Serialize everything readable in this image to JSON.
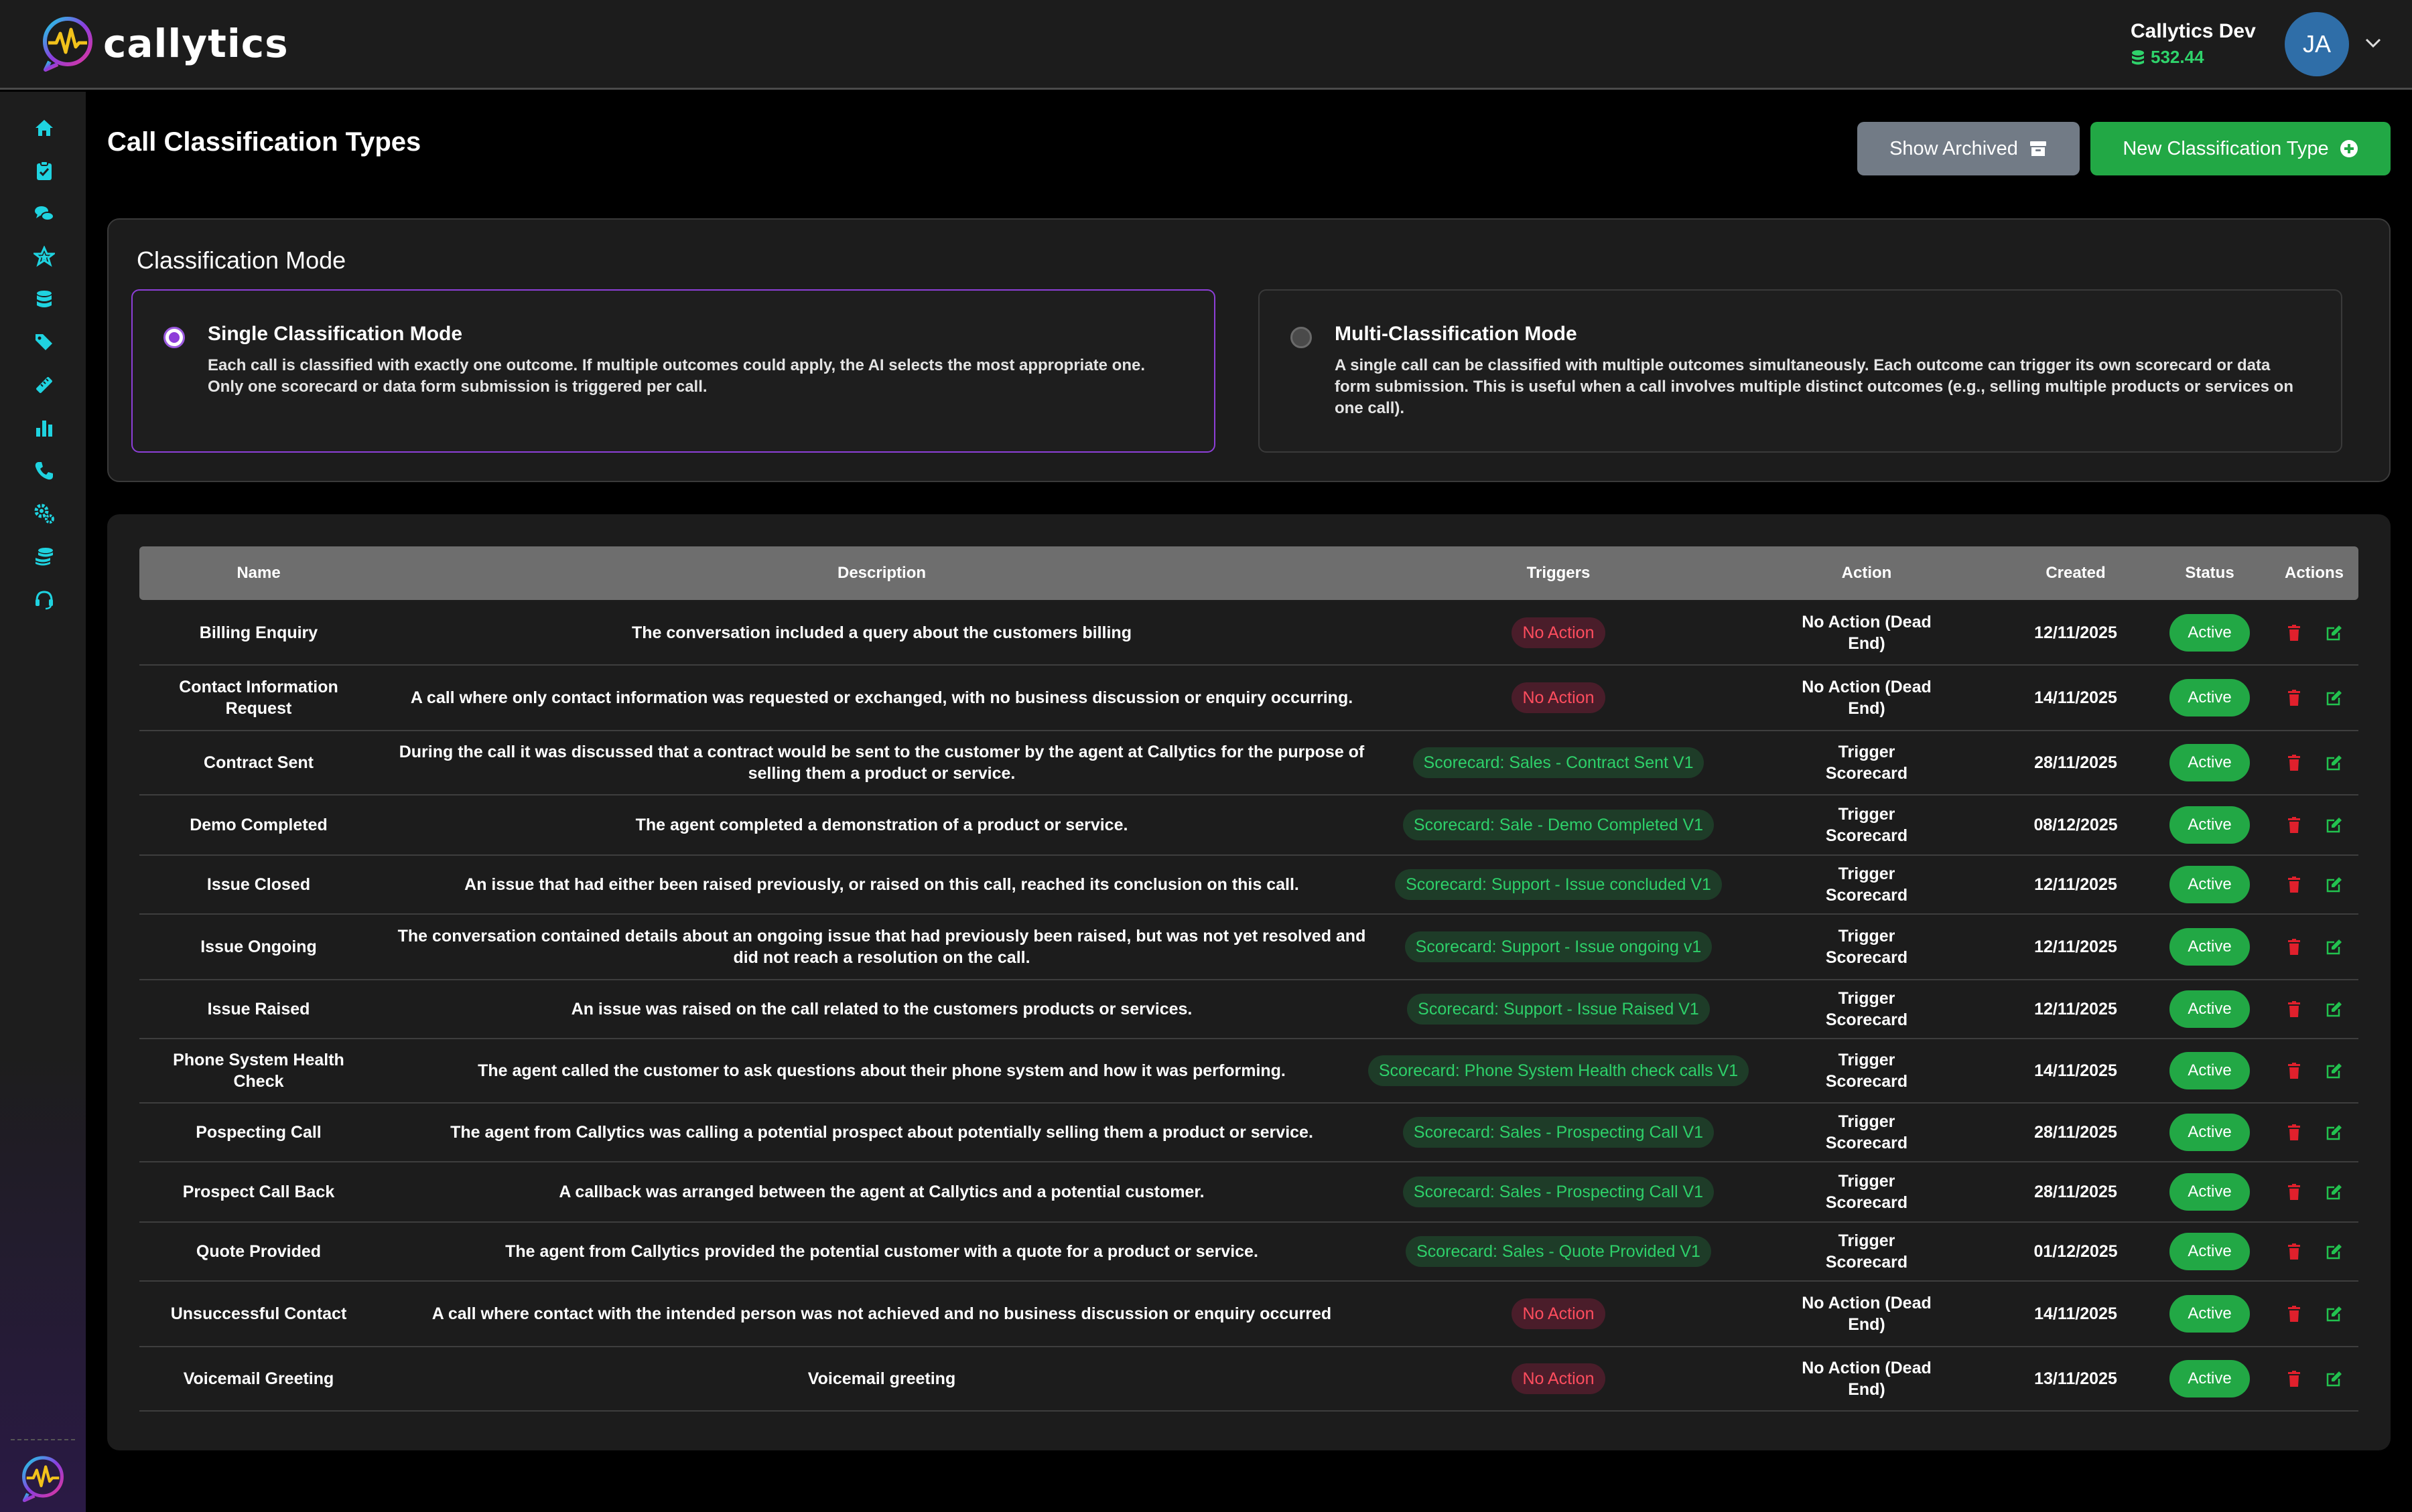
{
  "app": {
    "logo_text": "callytics",
    "account_name": "Callytics Dev",
    "credit": "532.44",
    "avatar_initials": "JA"
  },
  "sidebar": {
    "items": [
      "home-icon",
      "clipboard-check-icon",
      "chat-bubbles-icon",
      "star-icon",
      "database-icon",
      "tags-icon",
      "ruler-icon",
      "bar-chart-icon",
      "phone-icon",
      "gears-icon",
      "coins-icon",
      "headset-icon"
    ]
  },
  "page": {
    "title": "Call Classification Types",
    "show_archived_label": "Show Archived",
    "new_type_label": "New Classification Type"
  },
  "mode": {
    "title": "Classification Mode",
    "single": {
      "title": "Single Classification Mode",
      "desc": "Each call is classified with exactly one outcome. If multiple outcomes could apply, the AI selects the most appropriate one. Only one scorecard or data form submission is triggered per call.",
      "selected": true
    },
    "multi": {
      "title": "Multi-Classification Mode",
      "desc": "A single call can be classified with multiple outcomes simultaneously. Each outcome can trigger its own scorecard or data form submission. This is useful when a call involves multiple distinct outcomes (e.g., selling multiple products or services on one call).",
      "selected": false
    }
  },
  "table": {
    "headers": {
      "name": "Name",
      "description": "Description",
      "triggers": "Triggers",
      "action": "Action",
      "created": "Created",
      "status": "Status",
      "actions": "Actions"
    },
    "rows": [
      {
        "name": "Billing Enquiry",
        "description": "The conversation included a query about the customers billing",
        "trigger": "No Action",
        "trigger_type": "none",
        "action": "No Action (Dead End)",
        "created": "12/11/2025",
        "status": "Active"
      },
      {
        "name": "Contact Information Request",
        "description": "A call where only contact information was requested or exchanged, with no business discussion or enquiry occurring.",
        "trigger": "No Action",
        "trigger_type": "none",
        "action": "No Action (Dead End)",
        "created": "14/11/2025",
        "status": "Active"
      },
      {
        "name": "Contract Sent",
        "description": "During the call it was discussed that a contract would be sent to the customer by the agent at Callytics for the purpose of selling them a product or service.",
        "trigger": "Scorecard: Sales - Contract Sent V1",
        "trigger_type": "score",
        "action": "Trigger Scorecard",
        "created": "28/11/2025",
        "status": "Active"
      },
      {
        "name": "Demo Completed",
        "description": "The agent completed a demonstration of a product or service.",
        "trigger": "Scorecard: Sale - Demo Completed V1",
        "trigger_type": "score",
        "action": "Trigger Scorecard",
        "created": "08/12/2025",
        "status": "Active"
      },
      {
        "name": "Issue Closed",
        "description": "An issue that had either been raised previously, or raised on this call, reached its conclusion on this call.",
        "trigger": "Scorecard: Support - Issue concluded V1",
        "trigger_type": "score",
        "action": "Trigger Scorecard",
        "created": "12/11/2025",
        "status": "Active"
      },
      {
        "name": "Issue Ongoing",
        "description": "The conversation contained details about an ongoing issue that had previously been raised, but was not yet resolved and did not reach a resolution on the call.",
        "trigger": "Scorecard: Support - Issue ongoing v1",
        "trigger_type": "score",
        "action": "Trigger Scorecard",
        "created": "12/11/2025",
        "status": "Active"
      },
      {
        "name": "Issue Raised",
        "description": "An issue was raised on the call related to the customers products or services.",
        "trigger": "Scorecard: Support - Issue Raised V1",
        "trigger_type": "score",
        "action": "Trigger Scorecard",
        "created": "12/11/2025",
        "status": "Active"
      },
      {
        "name": "Phone System Health Check",
        "description": "The agent called the customer to ask questions about their phone system and how it was performing.",
        "trigger": "Scorecard: Phone System Health check calls V1",
        "trigger_type": "score",
        "action": "Trigger Scorecard",
        "created": "14/11/2025",
        "status": "Active"
      },
      {
        "name": "Pospecting Call",
        "description": "The agent from Callytics was calling a potential prospect about potentially selling them a product or service.",
        "trigger": "Scorecard: Sales - Prospecting Call V1",
        "trigger_type": "score",
        "action": "Trigger Scorecard",
        "created": "28/11/2025",
        "status": "Active"
      },
      {
        "name": "Prospect Call Back",
        "description": "A callback was arranged between the agent at Callytics and a potential customer.",
        "trigger": "Scorecard: Sales - Prospecting Call V1",
        "trigger_type": "score",
        "action": "Trigger Scorecard",
        "created": "28/11/2025",
        "status": "Active"
      },
      {
        "name": "Quote Provided",
        "description": "The agent from Callytics provided the potential customer with a quote for a product or service.",
        "trigger": "Scorecard: Sales - Quote Provided V1",
        "trigger_type": "score",
        "action": "Trigger Scorecard",
        "created": "01/12/2025",
        "status": "Active"
      },
      {
        "name": "Unsuccessful Contact",
        "description": "A call where contact with the intended person was not achieved and no business discussion or enquiry occurred",
        "trigger": "No Action",
        "trigger_type": "none",
        "action": "No Action (Dead End)",
        "created": "14/11/2025",
        "status": "Active"
      },
      {
        "name": "Voicemail Greeting",
        "description": "Voicemail greeting",
        "trigger": "No Action",
        "trigger_type": "none",
        "action": "No Action (Dead End)",
        "created": "13/11/2025",
        "status": "Active"
      }
    ]
  },
  "colors": {
    "accent_green": "#22a845",
    "accent_purple": "#8d3fd8",
    "no_action_red": "#ff4d5e",
    "sidebar_icon_cyan": "#1fd3e0"
  }
}
